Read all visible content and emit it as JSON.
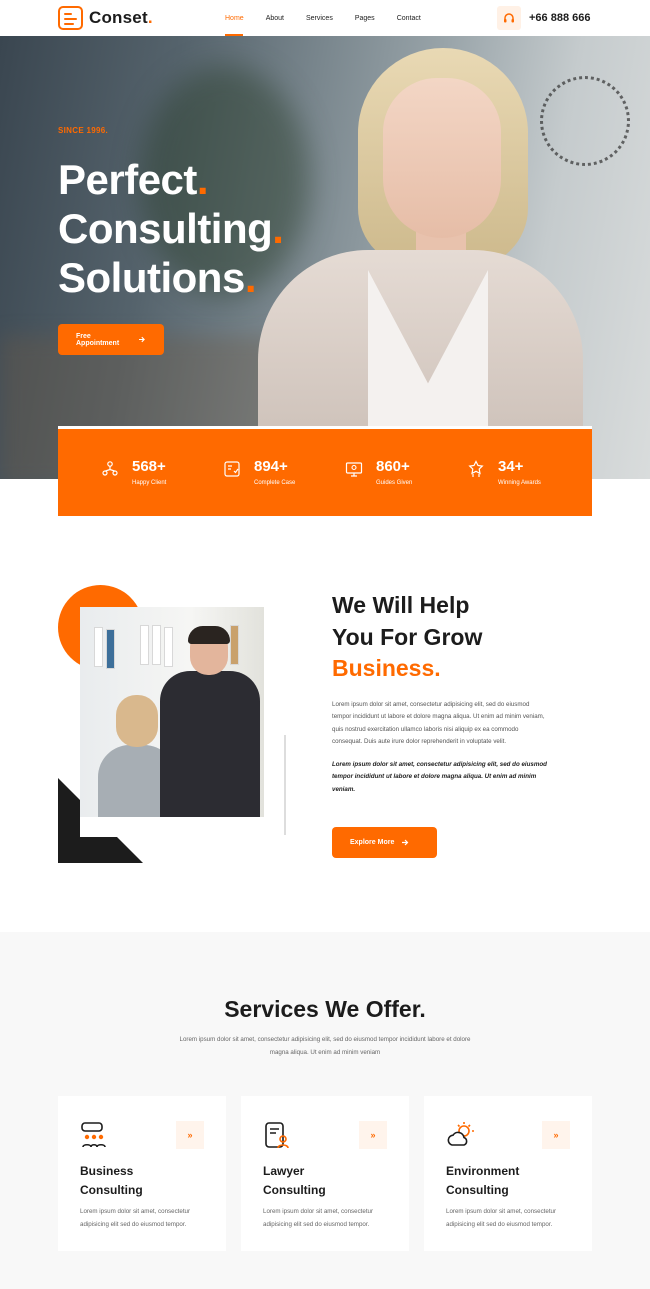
{
  "brand": {
    "name": "Conset",
    "dot": "."
  },
  "nav": {
    "items": [
      {
        "label": "Home",
        "active": true
      },
      {
        "label": "About",
        "active": false
      },
      {
        "label": "Services",
        "active": false
      },
      {
        "label": "Pages",
        "active": false
      },
      {
        "label": "Contact",
        "active": false
      }
    ],
    "phone": "+66 888 666",
    "phone_icon": "headphones-icon"
  },
  "hero": {
    "since": "SINCE 1996.",
    "title_lines": [
      "Perfect",
      "Consulting",
      "Solutions"
    ],
    "title_dot": ".",
    "button_label": "Free Appointment",
    "button_icon": "arrow-right-icon"
  },
  "stats": [
    {
      "value": "568+",
      "label": "Happy Client",
      "icon": "users-network-icon"
    },
    {
      "value": "894+",
      "label": "Complete Case",
      "icon": "case-document-icon"
    },
    {
      "value": "860+",
      "label": "Guides Given",
      "icon": "monitor-guide-icon"
    },
    {
      "value": "34+",
      "label": "Winning Awards",
      "icon": "award-icon"
    }
  ],
  "about": {
    "title_line1": "We Will Help",
    "title_line2": "You For Grow",
    "title_highlight": "Business.",
    "paragraph1": "Lorem ipsum dolor sit amet, consectetur adipisicing elit, sed do eiusmod tempor incididunt ut labore et dolore magna aliqua. Ut enim ad minim veniam, quis nostrud exercitation ullamco laboris nisi aliquip ex ea commodo consequat. Duis aute irure dolor reprehenderit in voluptate velit.",
    "paragraph2": "Lorem ipsum dolor sit amet, consectetur adipisicing elit, sed do eiusmod tempor incididunt ut labore et dolore magna aliqua. Ut enim ad minim veniam.",
    "button_label": "Explore More"
  },
  "services": {
    "title": "Services We Offer.",
    "subtitle": "Lorem ipsum dolor sit amet, consectetur adipisicing elit, sed do eiusmod tempor incididunt labore et dolore magna aliqua. Ut enim ad minim veniam",
    "cards": [
      {
        "title_line1": "Business",
        "title_line2": "Consulting",
        "text": "Lorem ipsum dolor sit amet, consectetur adipisicing elit sed do eiusmod tempor.",
        "icon": "business-people-icon",
        "arrow": "»"
      },
      {
        "title_line1": "Lawyer",
        "title_line2": "Consulting",
        "text": "Lorem ipsum dolor sit amet, consectetur adipisicing elit sed do eiusmod tempor.",
        "icon": "lawyer-document-icon",
        "arrow": "»"
      },
      {
        "title_line1": "Environment",
        "title_line2": "Consulting",
        "text": "Lorem ipsum dolor sit amet, consectetur adipisicing elit sed do eiusmod tempor.",
        "icon": "sun-cloud-icon",
        "arrow": "»"
      }
    ]
  },
  "colors": {
    "accent": "#ff6a00",
    "dark": "#1c1c1c"
  }
}
